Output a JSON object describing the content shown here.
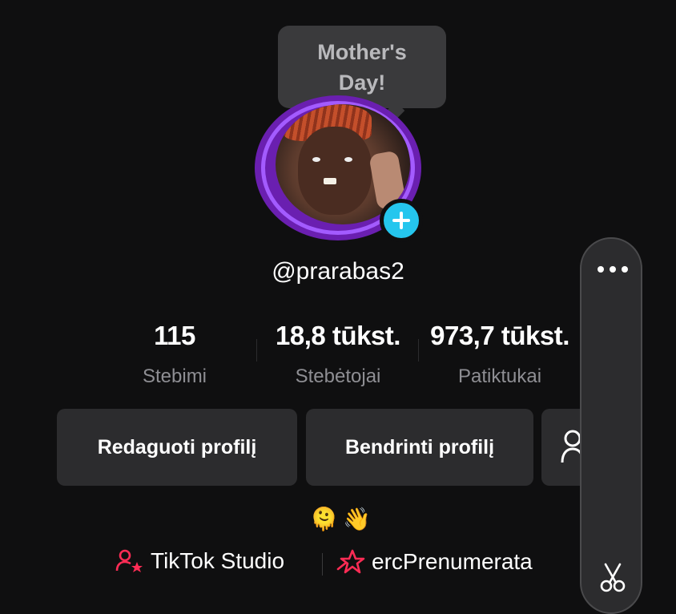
{
  "tooltip": {
    "line1": "Mother's",
    "line2": "Day!"
  },
  "profile": {
    "username": "@prarabas2",
    "add_icon": "plus-icon",
    "ring_color": "#a35bff",
    "badge_color": "#25c6ee"
  },
  "stats": [
    {
      "value": "115",
      "label": "Stebimi"
    },
    {
      "value": "18,8 tūkst.",
      "label": "Stebėtojai"
    },
    {
      "value": "973,7 tūkst.",
      "label": "Patiktukai"
    }
  ],
  "buttons": {
    "edit": "Redaguoti profilį",
    "share": "Bendrinti profilį",
    "add_friend_icon": "add-friend-icon"
  },
  "bio": {
    "emojis": [
      "🫠",
      "👋"
    ]
  },
  "links": {
    "studio": {
      "label": "TikTok Studio",
      "icon": "creator-star-icon",
      "color": "#fe2c55"
    },
    "subscription": {
      "label": "ercPrenumerata",
      "icon": "subscription-star-icon",
      "color": "#fe2c55"
    }
  },
  "side_panel": {
    "more_icon": "more-dots-icon",
    "bottom_icon": "scissors-icon"
  }
}
